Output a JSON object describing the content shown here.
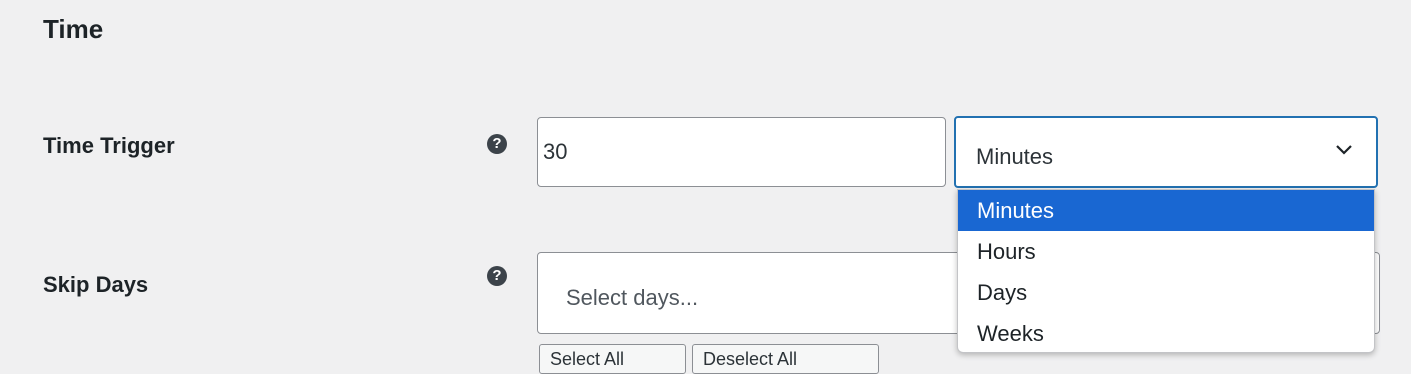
{
  "section": {
    "title": "Time"
  },
  "time_trigger": {
    "label": "Time Trigger",
    "help": "?",
    "value": "30",
    "unit_selected": "Minutes",
    "unit_options": [
      "Minutes",
      "Hours",
      "Days",
      "Weeks"
    ]
  },
  "skip_days": {
    "label": "Skip Days",
    "help": "?",
    "placeholder": "Select days...",
    "select_all_label": "Select All",
    "deselect_all_label": "Deselect All"
  },
  "colors": {
    "page_background": "#f0f0f1",
    "focus_border": "#2271b1",
    "selected_option": "#1967d2"
  }
}
